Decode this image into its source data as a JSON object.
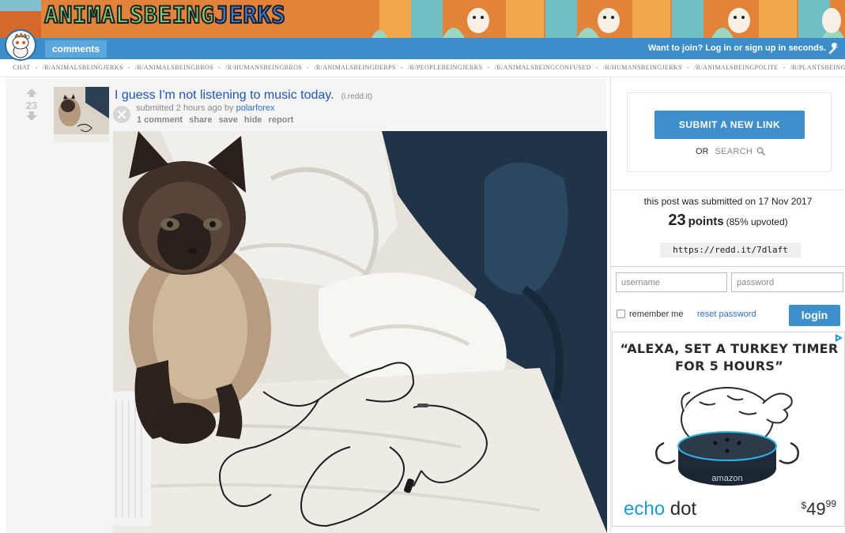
{
  "banner": {
    "logo_main": "ANIMALSBEING",
    "logo_accent": "JERKS"
  },
  "header": {
    "tab_comments": "comments",
    "join_text": "Want to join? Log in or sign up in seconds."
  },
  "subreddit_strip": {
    "items": [
      "chat",
      "/r/AnimalsBeingJerks",
      "/r/AnimalsBeingBros",
      "/r/HumansBeingBros",
      "/r/AnimalsBeingDerps",
      "/r/PeopleBeingJerks",
      "/r/AnimalsBeingConfused",
      "/r/HumansBeingJerks",
      "/r/AnimalsBeingPolite",
      "/r/PlantsBeingJerks"
    ],
    "separator": "-"
  },
  "post": {
    "score": "23",
    "title": "I guess I'm not listening to music today.",
    "domain": "(i.redd.it)",
    "submitted_prefix": "submitted",
    "time_ago": "2 hours ago",
    "by": "by",
    "author": "polarforex",
    "buttons": {
      "comments": "1 comment",
      "share": "share",
      "save": "save",
      "hide": "hide",
      "report": "report"
    }
  },
  "sidebar": {
    "submit_label": "SUBMIT A NEW LINK",
    "or_label": "OR",
    "search_label": "SEARCH",
    "submitted_on": "this post was submitted on 17 Nov 2017",
    "points": "23",
    "points_word": "points",
    "upvoted": "(85% upvoted)",
    "shortlink": "https://redd.it/7dlaft"
  },
  "login": {
    "username_placeholder": "username",
    "password_placeholder": "password",
    "remember_label": "remember me",
    "reset_label": "reset password",
    "login_button": "login"
  },
  "ad": {
    "headline_line1": "“ALEXA, SET A TURKEY TIMER",
    "headline_line2": "FOR 5 HOURS”",
    "device_brand": "amazon",
    "product_main": "echo",
    "product_dot": " dot",
    "price_currency": "$",
    "price_whole": "49",
    "price_cents": "99"
  },
  "colors": {
    "header_blue": "#3b8ec9",
    "link_blue": "#1a56c4",
    "button_blue": "#3e8fcc",
    "echo_blue": "#1b9cd8"
  },
  "icons": [
    "snoo-avatar-icon",
    "wrench-icon",
    "upvote-icon",
    "downvote-icon",
    "close-icon",
    "search-icon",
    "adchoices-icon"
  ]
}
